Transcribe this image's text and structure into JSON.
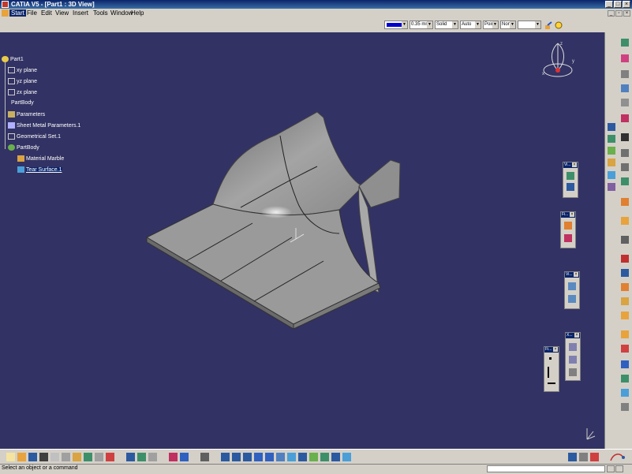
{
  "window": {
    "title": "CATIA V5 - [Part1 : 3D View]"
  },
  "menu": {
    "items": [
      "Start",
      "File",
      "Edit",
      "View",
      "Insert",
      "Tools",
      "Window",
      "Help"
    ],
    "active_index": 0
  },
  "toolbar_top": {
    "combos": [
      "",
      "0.35 mm",
      "Solid",
      "Auto",
      "Point",
      "None"
    ],
    "accent_color": "#0000cc"
  },
  "tree": {
    "items": [
      {
        "label": "Part1",
        "icon": "part-icon"
      },
      {
        "label": "xy plane",
        "icon": "plane-icon"
      },
      {
        "label": "yz plane",
        "icon": "plane-icon"
      },
      {
        "label": "zx plane",
        "icon": "plane-icon"
      },
      {
        "label": "PartBody",
        "icon": "body-icon"
      },
      {
        "label": "Parameters",
        "icon": "parameters-icon"
      },
      {
        "label": "Sheet Metal Parameters.1",
        "icon": "sheet-metal-icon"
      },
      {
        "label": "Geometrical Set.1",
        "icon": "geoset-icon"
      },
      {
        "label": "PartBody",
        "icon": "body-icon"
      },
      {
        "label": "Material Marble",
        "icon": "material-icon"
      },
      {
        "label": "Tear Surface.1",
        "icon": "surface-icon"
      }
    ],
    "selected_index": 10
  },
  "compass": {
    "axes": [
      "x",
      "y",
      "z"
    ]
  },
  "floating_toolbars": [
    "Vi...",
    "Fi...",
    "Vi...",
    "X...",
    "Fi..."
  ],
  "status": {
    "text": "Select an object or a command"
  },
  "colors": {
    "background": "#323264",
    "chrome": "#d4d0c8",
    "title_bar": "#0a246a"
  }
}
